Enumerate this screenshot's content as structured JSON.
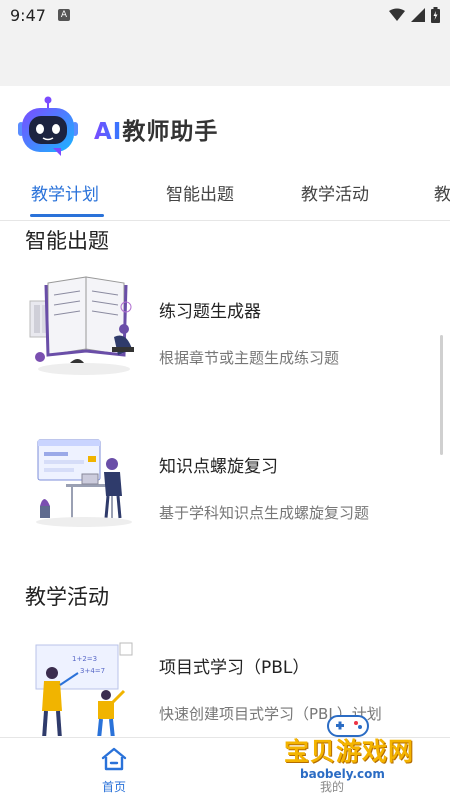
{
  "status_bar": {
    "time": "9:47",
    "notification_letter": "A"
  },
  "app": {
    "title_prefix": "AI",
    "title_rest": "教师助手"
  },
  "tabs": [
    {
      "label": "教学计划",
      "active": true
    },
    {
      "label": "智能出题",
      "active": false
    },
    {
      "label": "教学活动",
      "active": false
    },
    {
      "label": "教",
      "active": false
    }
  ],
  "sections": [
    {
      "title": "智能出题",
      "cards": [
        {
          "title": "练习题生成器",
          "description": "根据章节或主题生成练习题",
          "icon": "student-reading-illustration"
        },
        {
          "title": "知识点螺旋复习",
          "description": "基于学科知识点生成螺旋复习题",
          "icon": "desk-computer-illustration"
        }
      ]
    },
    {
      "title": "教学活动",
      "cards": [
        {
          "title": "项目式学习（PBL）",
          "description": "快速创建项目式学习（PBL）计划",
          "icon": "teacher-blackboard-illustration"
        }
      ]
    }
  ],
  "bottom_nav": {
    "home_label": "首页",
    "mine_label": "我的"
  },
  "watermark": {
    "brand": "宝贝游戏网",
    "url": "baobely.com"
  },
  "colors": {
    "accent": "#2a72d9",
    "logo_gradient_start": "#7b4bff",
    "logo_gradient_end": "#2f7bff"
  }
}
